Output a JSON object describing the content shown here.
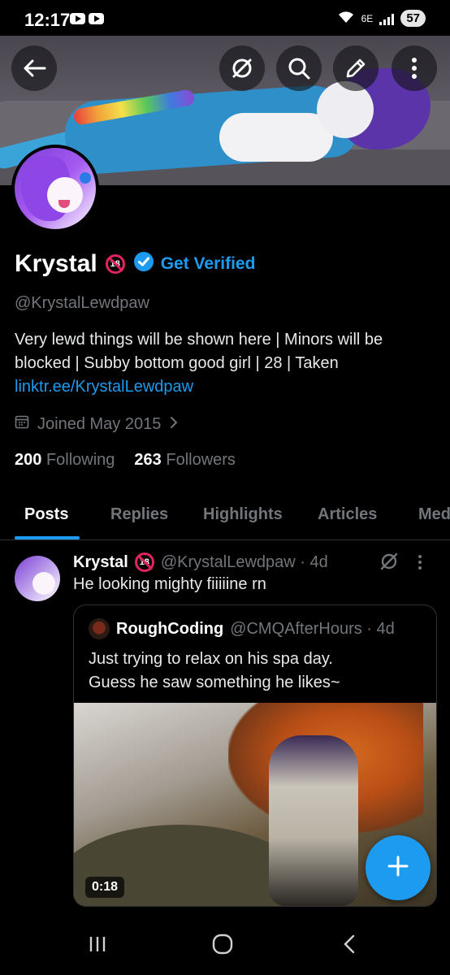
{
  "status_bar": {
    "time": "12:17",
    "network": "6E",
    "battery": "57"
  },
  "header": {
    "back_icon": "arrow-left-icon",
    "grok_icon": "grok-icon",
    "search_icon": "search-icon",
    "edit_icon": "pencil-icon",
    "more_icon": "more-vertical-icon"
  },
  "profile": {
    "name": "Krystal",
    "age_badge": "18",
    "verified_label": "Get Verified",
    "handle": "@KrystalLewdpaw",
    "bio": "Very lewd things will be shown here | Minors will be blocked | Subby bottom good girl | 28 | Taken",
    "link": "linktr.ee/KrystalLewdpaw",
    "joined": "Joined May 2015",
    "following_count": "200",
    "following_label": "Following",
    "followers_count": "263",
    "followers_label": "Followers"
  },
  "tabs": [
    "Posts",
    "Replies",
    "Highlights",
    "Articles",
    "Media"
  ],
  "post": {
    "author": "Krystal",
    "age_badge": "18",
    "meta": "@KrystalLewdpaw · 4d",
    "text": "He looking mighty fiiiiine rn",
    "quote": {
      "author": "RoughCoding",
      "meta": "@CMQAfterHours · 4d",
      "text_line1": "Just trying to relax on his spa day.",
      "text_line2": "Guess he saw something he likes~",
      "duration": "0:18"
    }
  },
  "fab_icon": "plus-icon",
  "nav": {
    "recents_icon": "recents-icon",
    "home_icon": "home-icon",
    "back_icon": "back-chevron-icon"
  },
  "colors": {
    "accent": "#1d9bf0",
    "background": "#000000",
    "muted": "#71767b",
    "badge_red": "#e0245e"
  }
}
